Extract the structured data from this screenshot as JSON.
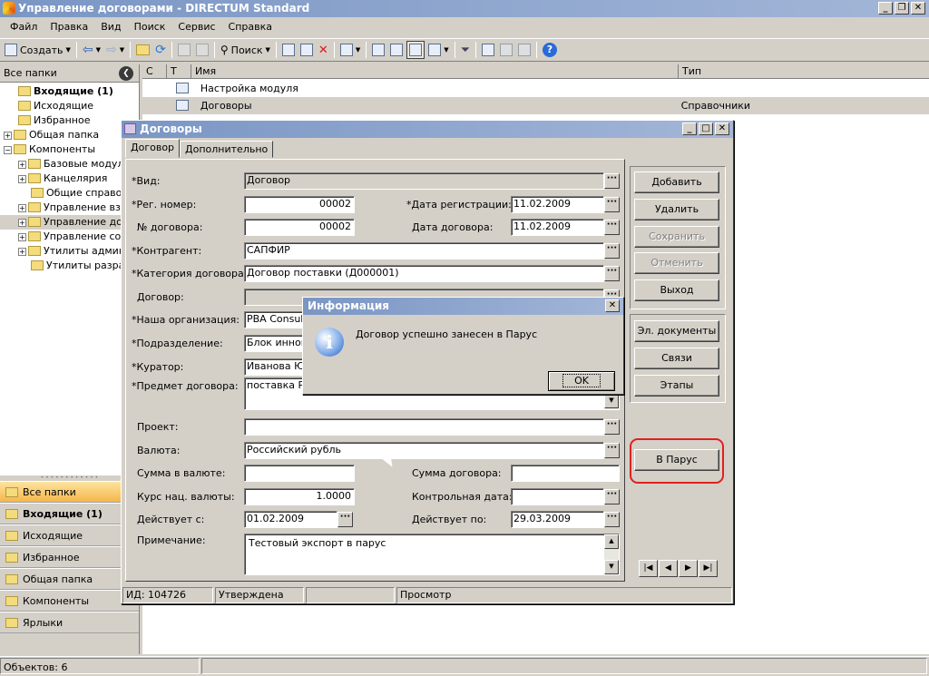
{
  "window": {
    "title": "Управление договорами - DIRECTUM Standard",
    "controls": [
      "_",
      "❐",
      "✕"
    ]
  },
  "menu": [
    "Файл",
    "Правка",
    "Вид",
    "Поиск",
    "Сервис",
    "Справка"
  ],
  "toolbar": {
    "create_label": "Создать",
    "search_label": "Поиск"
  },
  "left": {
    "header": "Все папки",
    "tree": [
      {
        "label": "Входящие (1)",
        "bold": true,
        "level": 1
      },
      {
        "label": "Исходящие",
        "level": 1
      },
      {
        "label": "Избранное",
        "level": 1
      },
      {
        "label": "Общая папка",
        "level": 0,
        "exp": "+"
      },
      {
        "label": "Компоненты",
        "level": 0,
        "exp": "−"
      },
      {
        "label": "Базовые модули",
        "level": 1,
        "exp": "+"
      },
      {
        "label": "Канцелярия",
        "level": 1,
        "exp": "+"
      },
      {
        "label": "Общие справочн",
        "level": 2
      },
      {
        "label": "Управление вза",
        "level": 1,
        "exp": "+"
      },
      {
        "label": "Управление дого",
        "level": 1,
        "exp": "+",
        "selected": true
      },
      {
        "label": "Управление сов",
        "level": 1,
        "exp": "+"
      },
      {
        "label": "Утилиты админи",
        "level": 1,
        "exp": "+"
      },
      {
        "label": "Утилиты разраб",
        "level": 2
      }
    ],
    "nav": [
      {
        "label": "Все папки",
        "active": true
      },
      {
        "label": "Входящие (1)",
        "bold": true
      },
      {
        "label": "Исходящие"
      },
      {
        "label": "Избранное"
      },
      {
        "label": "Общая папка"
      },
      {
        "label": "Компоненты"
      },
      {
        "label": "Ярлыки"
      }
    ]
  },
  "list": {
    "columns": [
      "С",
      "Т",
      "Имя",
      "Тип"
    ],
    "rows": [
      {
        "name": "Настройка модуля",
        "type": ""
      },
      {
        "name": "Договоры",
        "type": "Справочники",
        "selected": true
      }
    ]
  },
  "status": {
    "objects": "Объектов: 6"
  },
  "dialog": {
    "title": "Договоры",
    "tabs": [
      "Договор",
      "Дополнительно"
    ],
    "labels": {
      "kind": "*Вид:",
      "reg_no": "*Рег. номер:",
      "reg_date": "*Дата регистрации:",
      "contract_no": "№ договора:",
      "contract_date": "Дата договора:",
      "counterparty": "*Контрагент:",
      "category": "*Категория договора:",
      "contract": "Договор:",
      "our_org": "*Наша организация:",
      "division": "*Подразделение:",
      "curator": "*Куратор:",
      "subject": "*Предмет договора:",
      "project": "Проект:",
      "currency": "Валюта:",
      "sum_currency": "Сумма в валюте:",
      "sum_contract": "Сумма договора:",
      "rate": "Курс нац. валюты:",
      "control_date": "Контрольная дата:",
      "valid_from": "Действует с:",
      "valid_to": "Действует по:",
      "note": "Примечание:"
    },
    "values": {
      "kind": "Договор",
      "reg_no": "00002",
      "reg_date": "11.02.2009",
      "contract_no": "00002",
      "contract_date": "11.02.2009",
      "counterparty": "САПФИР",
      "category": "Договор поставки (Д000001)",
      "contract": "",
      "our_org": "РВА Consult",
      "division": "Блок инновац",
      "curator": "Иванова Юли",
      "subject": "поставка РП",
      "project": "",
      "currency": "Российский рубль",
      "sum_currency": "",
      "sum_contract": "",
      "rate": "1.0000",
      "control_date": "",
      "valid_from": "01.02.2009",
      "valid_to": "29.03.2009",
      "note": "Тестовый экспорт в парус"
    },
    "buttons": {
      "add": "Добавить",
      "delete": "Удалить",
      "save": "Сохранить",
      "cancel": "Отменить",
      "exit": "Выход",
      "edocs": "Эл. документы",
      "links": "Связи",
      "stages": "Этапы",
      "parus": "В Парус"
    },
    "nav_buttons": [
      "|◀",
      "◀",
      "▶",
      "▶|"
    ],
    "statusbar": {
      "id": "ИД: 104726",
      "state": "Утверждена",
      "mode": "Просмотр"
    }
  },
  "info": {
    "title": "Информация",
    "message": "Договор успешно занесен в Парус",
    "ok": "OK"
  },
  "colors": {
    "title_gradient_start": "#7a96c4",
    "title_gradient_end": "#a3b6d8",
    "highlight_box": "#e02020",
    "nav_active": "#f6b64a"
  }
}
